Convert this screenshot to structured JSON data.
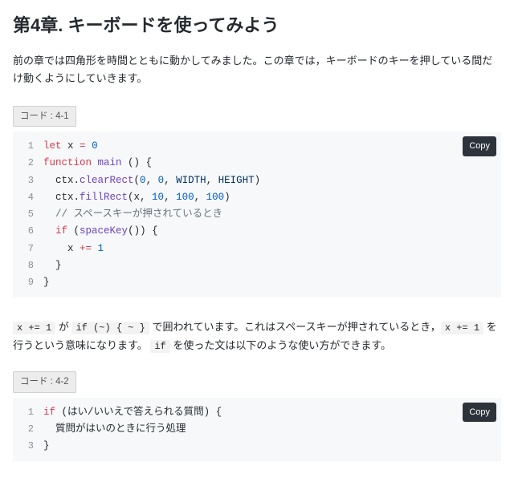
{
  "heading": "第4章. キーボードを使ってみよう",
  "intro": "前の章では四角形を時間とともに動かしてみました。この章では，キーボードのキーを押している間だけ動くようにしていきます。",
  "copy_label": "Copy",
  "code1": {
    "label": "コード : 4-1",
    "lines": [
      [
        {
          "c": "kw",
          "t": "let"
        },
        {
          "c": "pl",
          "t": " x "
        },
        {
          "c": "kw",
          "t": "="
        },
        {
          "c": "pl",
          "t": " "
        },
        {
          "c": "num",
          "t": "0"
        }
      ],
      [
        {
          "c": "kw",
          "t": "function"
        },
        {
          "c": "pl",
          "t": " "
        },
        {
          "c": "def",
          "t": "main"
        },
        {
          "c": "pl",
          "t": " () {"
        }
      ],
      [
        {
          "c": "pl",
          "t": "  ctx."
        },
        {
          "c": "def",
          "t": "clearRect"
        },
        {
          "c": "pl",
          "t": "("
        },
        {
          "c": "num",
          "t": "0"
        },
        {
          "c": "pl",
          "t": ", "
        },
        {
          "c": "num",
          "t": "0"
        },
        {
          "c": "pl",
          "t": ", "
        },
        {
          "c": "id",
          "t": "WIDTH"
        },
        {
          "c": "pl",
          "t": ", "
        },
        {
          "c": "id",
          "t": "HEIGHT"
        },
        {
          "c": "pl",
          "t": ")"
        }
      ],
      [
        {
          "c": "pl",
          "t": "  ctx."
        },
        {
          "c": "def",
          "t": "fillRect"
        },
        {
          "c": "pl",
          "t": "(x, "
        },
        {
          "c": "num",
          "t": "10"
        },
        {
          "c": "pl",
          "t": ", "
        },
        {
          "c": "num",
          "t": "100"
        },
        {
          "c": "pl",
          "t": ", "
        },
        {
          "c": "num",
          "t": "100"
        },
        {
          "c": "pl",
          "t": ")"
        }
      ],
      [
        {
          "c": "pl",
          "t": "  "
        },
        {
          "c": "com",
          "t": "// スペースキーが押されているとき"
        }
      ],
      [
        {
          "c": "pl",
          "t": "  "
        },
        {
          "c": "kw",
          "t": "if"
        },
        {
          "c": "pl",
          "t": " ("
        },
        {
          "c": "def",
          "t": "spaceKey"
        },
        {
          "c": "pl",
          "t": "()) {"
        }
      ],
      [
        {
          "c": "pl",
          "t": "    x "
        },
        {
          "c": "kw",
          "t": "+="
        },
        {
          "c": "pl",
          "t": " "
        },
        {
          "c": "num",
          "t": "1"
        }
      ],
      [
        {
          "c": "pl",
          "t": "  }"
        }
      ],
      [
        {
          "c": "pl",
          "t": "}"
        }
      ]
    ]
  },
  "explain": {
    "seg1": " が ",
    "seg2": " で囲われています。これはスペースキーが押されているとき，",
    "seg3": " を行うという意味になります。 ",
    "seg4": " を使った文は以下のような使い方ができます。",
    "inline_a": "x += 1",
    "inline_b": "if (~) { ~ }",
    "inline_c": "x += 1",
    "inline_d": "if"
  },
  "code2": {
    "label": "コード : 4-2",
    "lines": [
      [
        {
          "c": "kw",
          "t": "if"
        },
        {
          "c": "pl",
          "t": " (はい/いいえで答えられる質問) {"
        }
      ],
      [
        {
          "c": "pl",
          "t": "  質問がはいのときに行う処理"
        }
      ],
      [
        {
          "c": "pl",
          "t": "}"
        }
      ]
    ]
  }
}
